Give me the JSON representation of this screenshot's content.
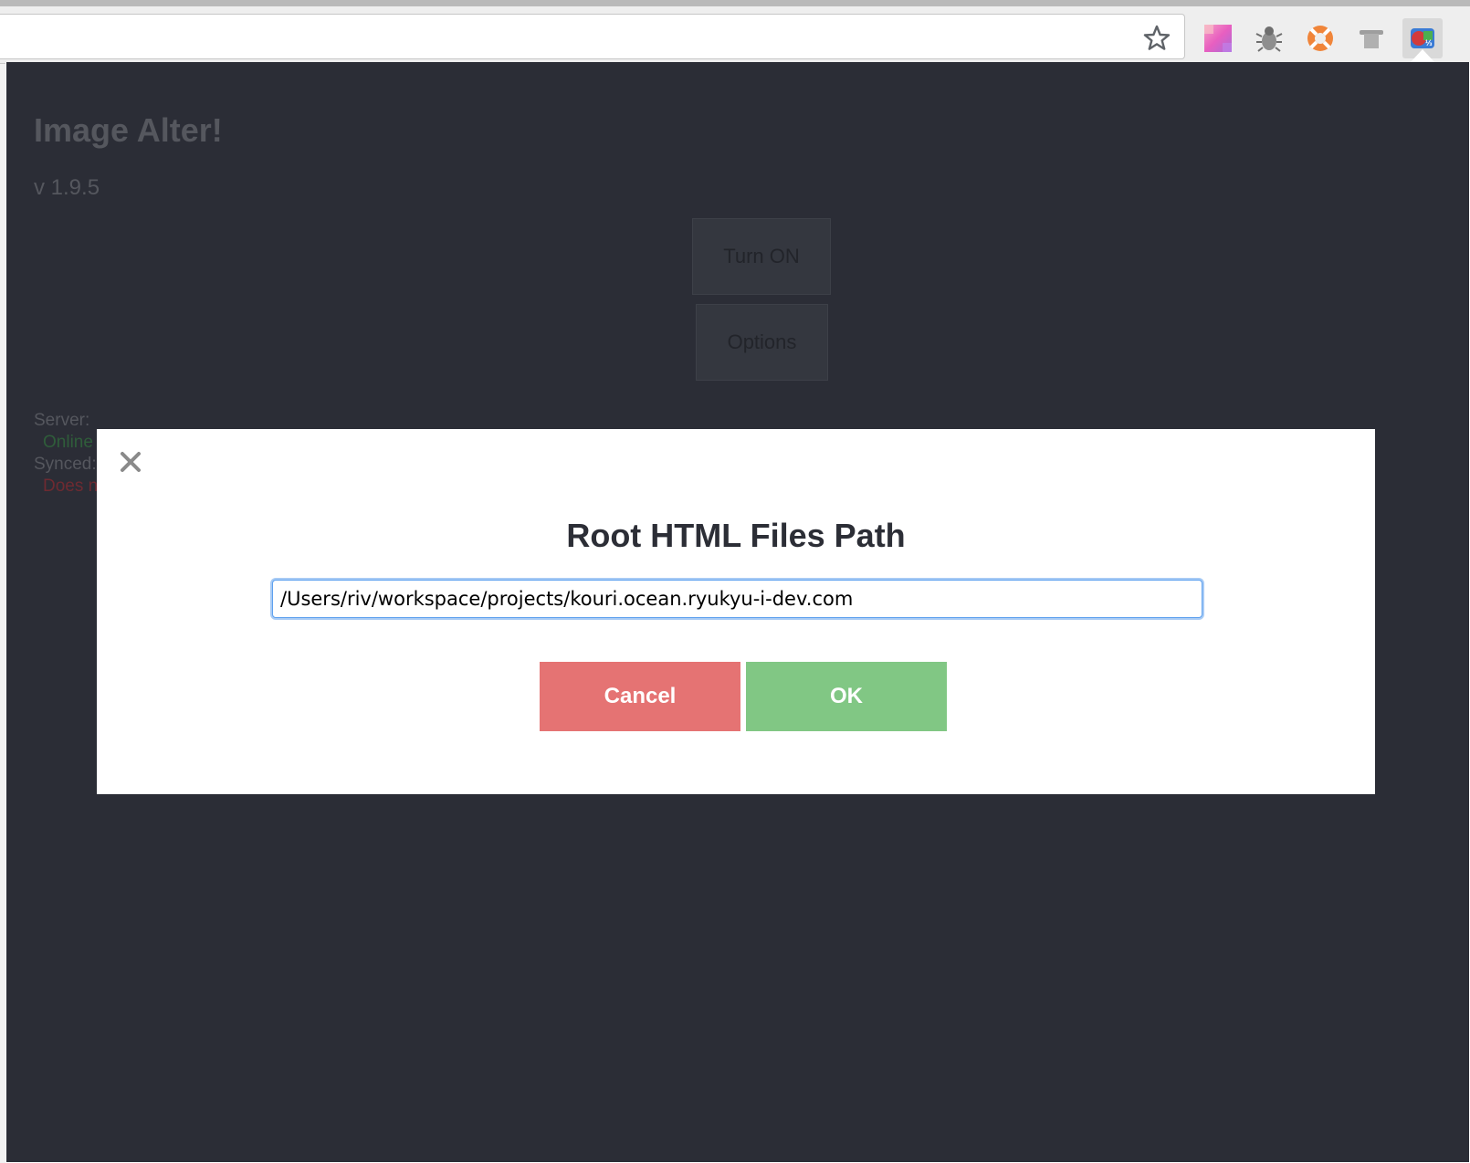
{
  "browser": {
    "extensions": [
      {
        "name": "color-palette-extension-icon"
      },
      {
        "name": "bug-extension-icon"
      },
      {
        "name": "lifebuoy-extension-icon"
      },
      {
        "name": "top-hat-extension-icon"
      },
      {
        "name": "image-alter-extension-icon",
        "active": true
      }
    ]
  },
  "app": {
    "title": "Image Alter!",
    "version": "v 1.9.5",
    "turn_on_label": "Turn ON",
    "options_label": "Options",
    "server_label": "Server:",
    "server_status": "Online",
    "synced_label": "Synced:",
    "synced_status": "Does n",
    "colors": {
      "online": "#2f5d3a",
      "not_synced": "#6e2a31",
      "background": "#2b2d36"
    }
  },
  "modal": {
    "title": "Root HTML Files Path",
    "path_value": "/Users/riv/workspace/projects/kouri.ocean.ryukyu-i-dev.com",
    "cancel_label": "Cancel",
    "ok_label": "OK",
    "colors": {
      "cancel": "#e57373",
      "ok": "#81c784"
    }
  }
}
